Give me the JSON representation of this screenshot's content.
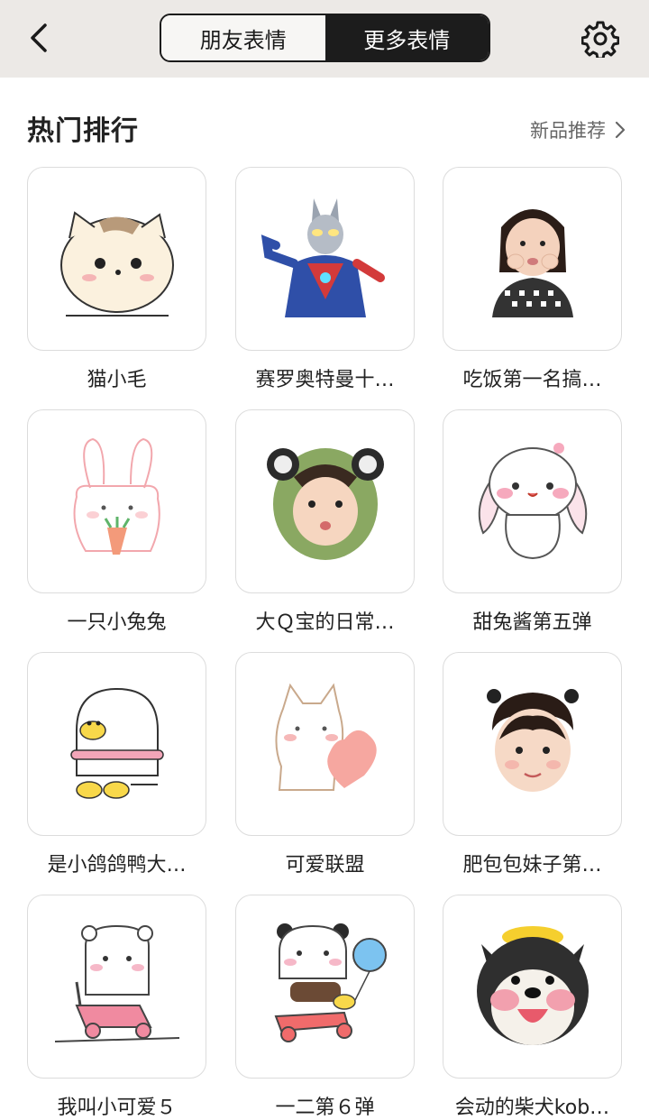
{
  "header": {
    "tabs": [
      {
        "label": "朋友表情",
        "active": false
      },
      {
        "label": "更多表情",
        "active": true
      }
    ]
  },
  "section": {
    "title": "热门排行",
    "more_label": "新品推荐"
  },
  "stickers": [
    {
      "name": "猫小毛",
      "icon": "cat-sticker-icon"
    },
    {
      "name": "赛罗奥特曼十…",
      "icon": "ultraman-sticker-icon"
    },
    {
      "name": "吃饭第一名搞…",
      "icon": "girl-sticker-icon"
    },
    {
      "name": "一只小兔兔",
      "icon": "bunny-carrot-sticker-icon"
    },
    {
      "name": "大Ｑ宝的日常…",
      "icon": "baby-frog-hat-sticker-icon"
    },
    {
      "name": "甜兔酱第五弹",
      "icon": "sweet-bunny-sticker-icon"
    },
    {
      "name": "是小鸽鸽鸭大…",
      "icon": "duck-sticker-icon"
    },
    {
      "name": "可爱联盟",
      "icon": "heart-cat-sticker-icon"
    },
    {
      "name": "肥包包妹子第…",
      "icon": "pigtail-girl-sticker-icon"
    },
    {
      "name": "我叫小可爱５",
      "icon": "bear-scooter-sticker-icon"
    },
    {
      "name": "一二第６弹",
      "icon": "panda-scooter-sticker-icon"
    },
    {
      "name": "会动的柴犬kob…",
      "icon": "shiba-dog-sticker-icon"
    }
  ],
  "colors": {
    "topbar_bg": "#ece9e6",
    "active_tab_bg": "#1c1c1c",
    "card_border": "#dcdcdc"
  }
}
